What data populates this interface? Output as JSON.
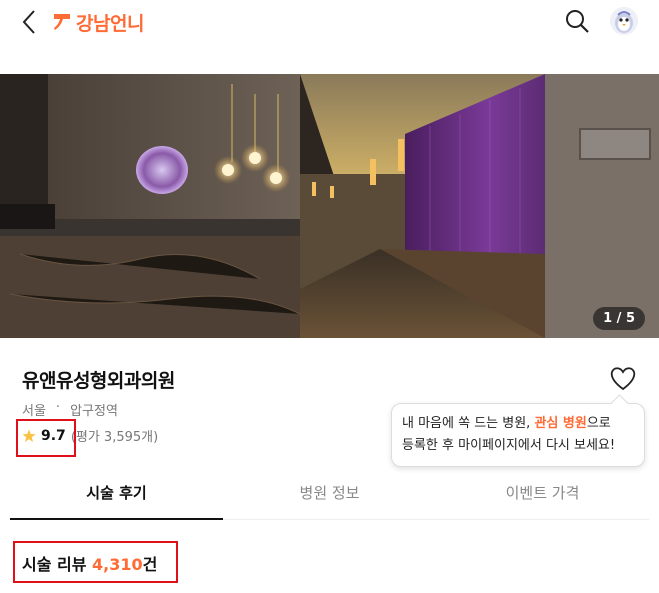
{
  "header": {
    "logo_text": "강남언니",
    "back_icon": "chevron-left-icon",
    "search_icon": "search-icon",
    "avatar_icon": "avatar-icon",
    "brand_color": "#ff6b35"
  },
  "hero": {
    "pager": "1 / 5"
  },
  "hospital": {
    "name": "유앤유성형외과의원",
    "city": "서울",
    "separator": "·",
    "station": "압구정역",
    "rating_score": "9.7",
    "rating_count": "(평가 3,595개)"
  },
  "tooltip": {
    "line1_pre": "내 마음에 쏙 드는 병원, ",
    "line1_accent": "관심 병원",
    "line1_post": "으로",
    "line2": "등록한 후 마이페이지에서 다시 보세요!"
  },
  "tabs": [
    {
      "label": "시술 후기",
      "active": true
    },
    {
      "label": "병원 정보",
      "active": false
    },
    {
      "label": "이벤트 가격",
      "active": false
    }
  ],
  "reviews": {
    "label": "시술 리뷰",
    "count": "4,310",
    "unit": "건"
  },
  "colors": {
    "accent": "#ff6b35",
    "highlight_box": "#e0101a"
  }
}
